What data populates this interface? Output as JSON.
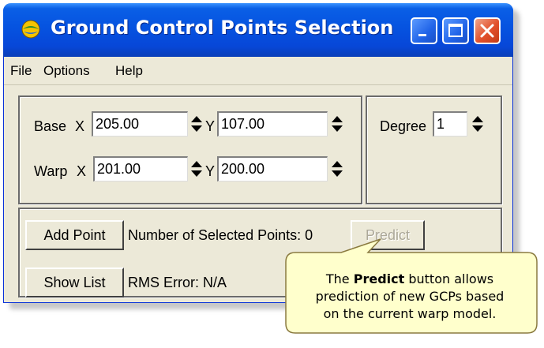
{
  "window": {
    "title": "Ground Control Points Selection"
  },
  "menu": [
    "File",
    "Options",
    "Help"
  ],
  "base": {
    "label": "Base",
    "x_label": "X",
    "x_value": "205.00",
    "y_label": "Y",
    "y_value": "107.00"
  },
  "warp": {
    "label": "Warp",
    "x_label": "X",
    "x_value": "201.00",
    "y_label": "Y",
    "y_value": "200.00"
  },
  "degree": {
    "label": "Degree",
    "value": "1"
  },
  "actions": {
    "add_point": "Add Point",
    "selected_points_label": "Number of Selected Points: 0",
    "predict": "Predict",
    "show_list": "Show List",
    "rms_error": "RMS Error: N/A"
  },
  "callout": {
    "prefix": "The ",
    "bold": "Predict",
    "line1_suffix": " button allows",
    "line2": "prediction of new GCPs based",
    "line3": "on the current warp model."
  },
  "colors": {
    "title_bar": "#0653e0",
    "window_bg": "#ece9d8",
    "callout_fill": "#ffffcc",
    "callout_border": "#8a7a40",
    "close_button": "#e2502c"
  },
  "icons": {
    "app": "globe-icon",
    "minimize": "minimize-icon",
    "maximize": "maximize-icon",
    "close": "close-icon",
    "spinner": "spinner-arrows-icon"
  }
}
